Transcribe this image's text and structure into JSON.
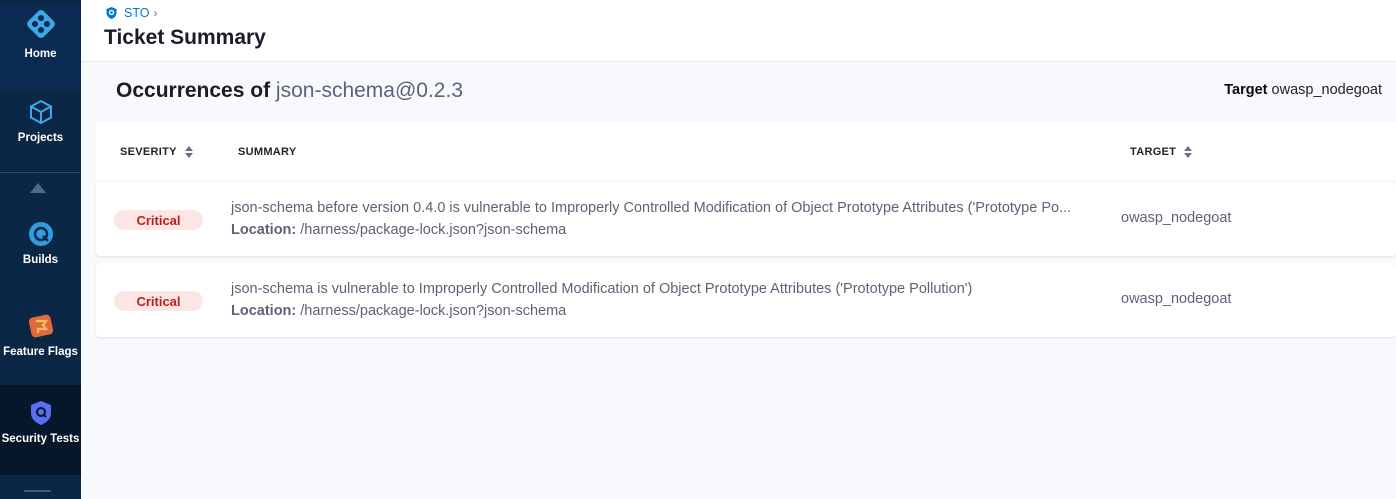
{
  "sidebar": {
    "items": [
      {
        "label": "Home",
        "icon": "home-icon"
      },
      {
        "label": "Projects",
        "icon": "cube-icon"
      },
      {
        "label": "Builds",
        "icon": "builds-icon"
      },
      {
        "label": "Feature Flags",
        "icon": "flag-icon"
      },
      {
        "label": "Security Tests",
        "icon": "shield-icon"
      }
    ]
  },
  "header": {
    "breadcrumb": "STO",
    "title": "Ticket Summary"
  },
  "main": {
    "occurrences_prefix": "Occurrences of",
    "package": "json-schema@0.2.3",
    "target_label": "Target",
    "target_value": "owasp_nodegoat",
    "columns": {
      "severity": "SEVERITY",
      "summary": "SUMMARY",
      "target": "TARGET"
    },
    "location_label": "Location:",
    "rows": [
      {
        "severity": "Critical",
        "summary": "json-schema before version 0.4.0 is vulnerable to Improperly Controlled Modification of Object Prototype Attributes ('Prototype Po...",
        "location": "/harness/package-lock.json?json-schema",
        "target": "owasp_nodegoat"
      },
      {
        "severity": "Critical",
        "summary": "json-schema is vulnerable to Improperly Controlled Modification of Object Prototype Attributes ('Prototype Pollution')",
        "location": "/harness/package-lock.json?json-schema",
        "target": "owasp_nodegoat"
      }
    ]
  },
  "colors": {
    "sidebar_bg": "#0b2746",
    "accent": "#0278d5",
    "critical_text": "#c41c1c",
    "critical_bg": "#fbe6e4"
  }
}
